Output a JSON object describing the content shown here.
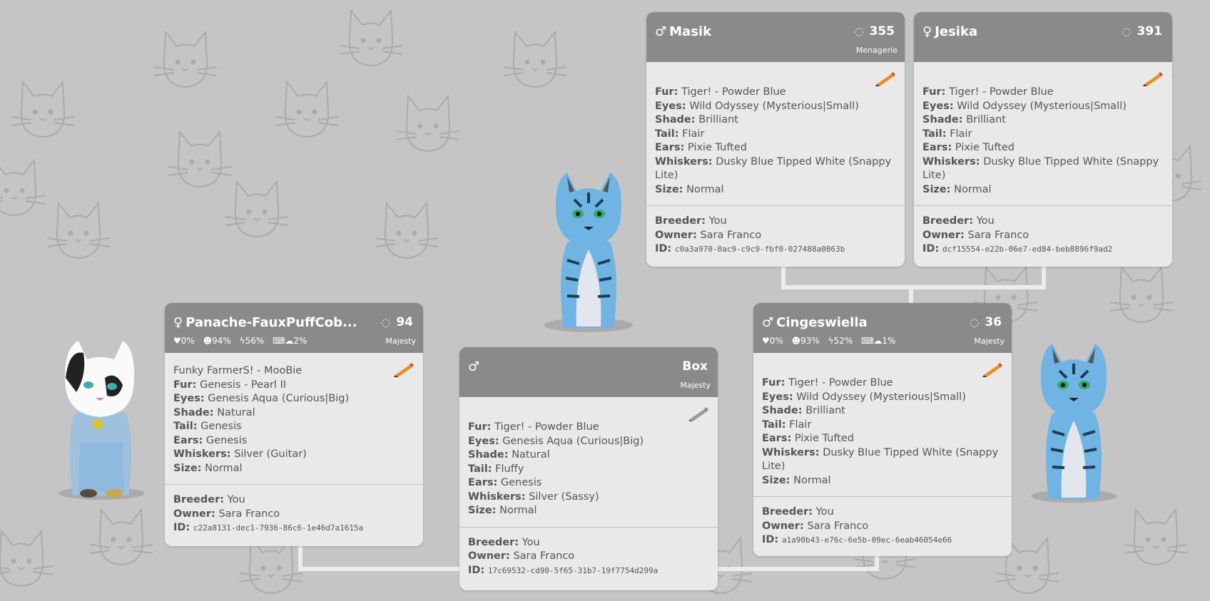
{
  "colors": {
    "background": "#c5c5c5",
    "header": "#8a8a8a",
    "card": "#e9e9e9",
    "cat_blue": "#6fb4e3"
  },
  "cards": {
    "masik": {
      "gender": "♂",
      "name": "Masik",
      "count": "355",
      "sub": "Menagerie",
      "fur": "Tiger! - Powder Blue",
      "eyes": "Wild Odyssey (Mysterious|Small)",
      "shade": "Brilliant",
      "tail": "Flair",
      "ears": "Pixie Tufted",
      "whiskers": "Dusky Blue Tipped White (Snappy Lite)",
      "size": "Normal",
      "breeder": "You",
      "owner": "Sara Franco",
      "id": "c0a3a970-0ac9-c9c9-fbf0-027488a0863b"
    },
    "jesika": {
      "gender": "♀",
      "name": "Jesika",
      "count": "391",
      "fur": "Tiger! - Powder Blue",
      "eyes": "Wild Odyssey (Mysterious|Small)",
      "shade": "Brilliant",
      "tail": "Flair",
      "ears": "Pixie Tufted",
      "whiskers": "Dusky Blue Tipped White (Snappy Lite)",
      "size": "Normal",
      "breeder": "You",
      "owner": "Sara Franco",
      "id": "dcf15554-e22b-06e7-ed84-beb8896f9ad2"
    },
    "panache": {
      "gender": "♀",
      "name": "Panache-FauxPuffCob...",
      "count": "94",
      "sub": "Majesty",
      "stats": [
        "♥0%",
        "☻94%",
        "ϟ56%",
        "⌨☁2%"
      ],
      "outfit": "Funky FarmerS! - MooBie",
      "fur": "Genesis - Pearl II",
      "eyes": "Genesis Aqua (Curious|Big)",
      "shade": "Natural",
      "tail": "Genesis",
      "ears": "Genesis",
      "whiskers": "Silver (Guitar)",
      "size": "Normal",
      "breeder": "You",
      "owner": "Sara Franco",
      "id": "c22a8131-dec1-7936-86c6-1e46d7a1615a"
    },
    "box": {
      "gender": "♂",
      "name": "Box",
      "sub": "Majesty",
      "fur": "Tiger! - Powder Blue",
      "eyes": "Genesis Aqua (Curious|Big)",
      "shade": "Natural",
      "tail": "Fluffy",
      "ears": "Genesis",
      "whiskers": "Silver (Sassy)",
      "size": "Normal",
      "breeder": "You",
      "owner": "Sara Franco",
      "id": "17c69532-cd90-5f65-31b7-19f7754d299a"
    },
    "cinges": {
      "gender": "♂",
      "name": "Cingeswiella",
      "count": "36",
      "sub": "Majesty",
      "stats": [
        "♥0%",
        "☻93%",
        "ϟ52%",
        "⌨☁1%"
      ],
      "fur": "Tiger! - Powder Blue",
      "eyes": "Wild Odyssey (Mysterious|Small)",
      "shade": "Brilliant",
      "tail": "Flair",
      "ears": "Pixie Tufted",
      "whiskers": "Dusky Blue Tipped White (Snappy Lite)",
      "size": "Normal",
      "breeder": "You",
      "owner": "Sara Franco",
      "id": "a1a90b43-e76c-6e5b-09ec-6eab46054e66"
    }
  },
  "labels": {
    "fur": "Fur:",
    "eyes": "Eyes:",
    "shade": "Shade:",
    "tail": "Tail:",
    "ears": "Ears:",
    "whiskers": "Whiskers:",
    "size": "Size:",
    "breeder": "Breeder:",
    "owner": "Owner:",
    "id": "ID:"
  },
  "icons": {
    "loader": "loader-ring-icon",
    "edit": "pencil-icon"
  }
}
